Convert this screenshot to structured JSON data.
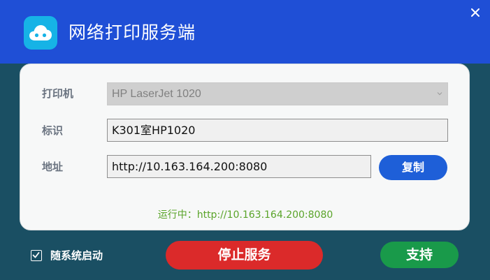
{
  "window": {
    "title": "网络打印服务端",
    "logo_icon": "cloud-icon",
    "close_icon": "close-icon"
  },
  "form": {
    "printer": {
      "label": "打印机",
      "value": "HP LaserJet 1020"
    },
    "name": {
      "label": "标识",
      "value": "K301室HP1020"
    },
    "address": {
      "label": "地址",
      "value": "http://10.163.164.200:8080"
    },
    "copy_label": "复制"
  },
  "status": {
    "text": "运行中：http://10.163.164.200:8080"
  },
  "bottom": {
    "autostart_label": "随系统启动",
    "autostart_checked": true,
    "stop_label": "停止服务",
    "support_label": "支持"
  },
  "colors": {
    "titlebar": "#1f4fd6",
    "background": "#1a4f63",
    "copy_button": "#1e5fd8",
    "stop_button": "#db2a2a",
    "support_button": "#199a4a",
    "status_text": "#5aa42a"
  }
}
